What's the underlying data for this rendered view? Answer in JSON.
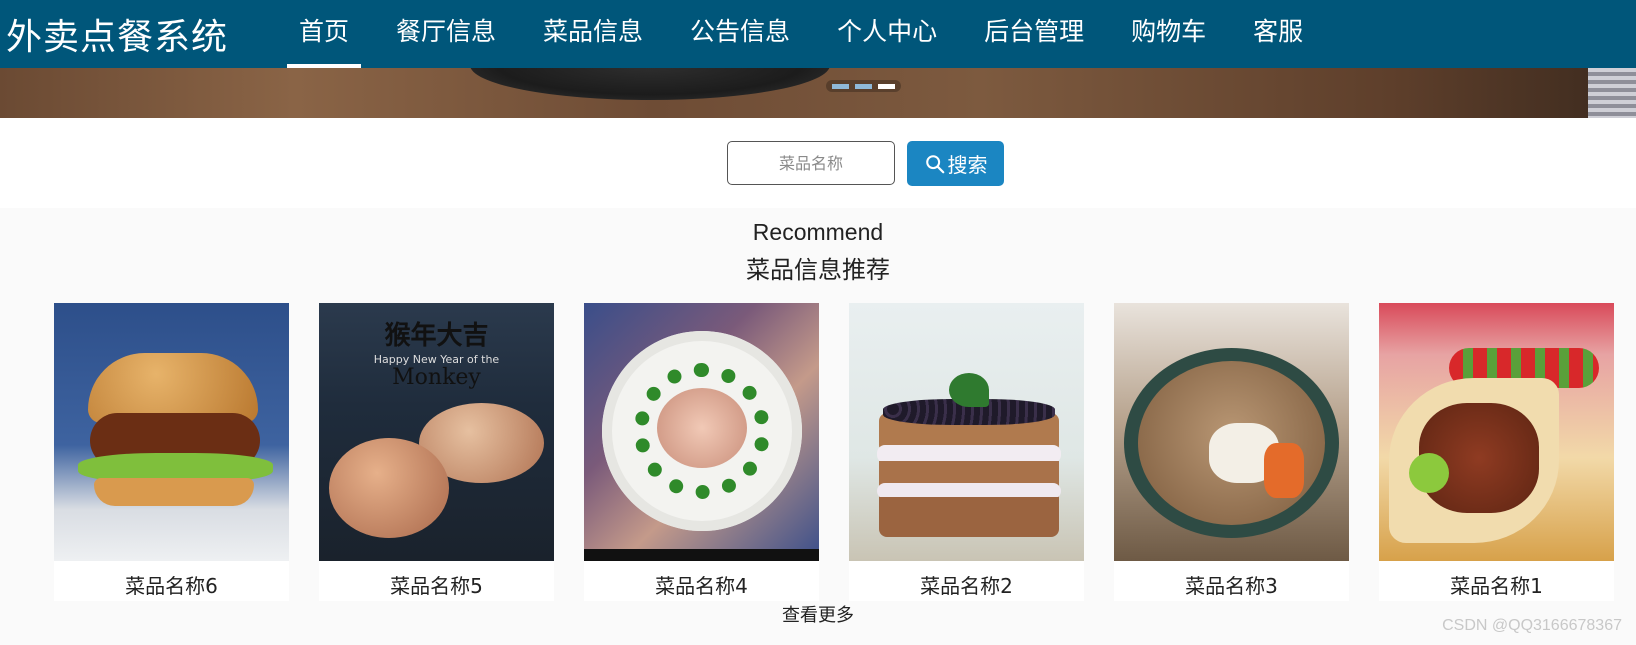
{
  "brand": "外卖点餐系统",
  "nav": {
    "items": [
      {
        "label": "首页",
        "active": true
      },
      {
        "label": "餐厅信息",
        "active": false
      },
      {
        "label": "菜品信息",
        "active": false
      },
      {
        "label": "公告信息",
        "active": false
      },
      {
        "label": "个人中心",
        "active": false
      },
      {
        "label": "后台管理",
        "active": false
      },
      {
        "label": "购物车",
        "active": false
      },
      {
        "label": "客服",
        "active": false
      }
    ]
  },
  "carousel": {
    "slide_count": 3,
    "active_index": 2
  },
  "search": {
    "placeholder": "菜品名称",
    "value": "",
    "button_label": "搜索",
    "icon": "search-icon"
  },
  "recommend": {
    "title_en": "Recommend",
    "title_cn": "菜品信息推荐",
    "items": [
      {
        "name": "菜品名称6",
        "image": "burger"
      },
      {
        "name": "菜品名称5",
        "image": "cookies"
      },
      {
        "name": "菜品名称4",
        "image": "plated-dish"
      },
      {
        "name": "菜品名称2",
        "image": "blackberry-cake"
      },
      {
        "name": "菜品名称3",
        "image": "stew-soup"
      },
      {
        "name": "菜品名称1",
        "image": "tacos"
      }
    ],
    "more_label": "查看更多"
  },
  "cookie_image_text": {
    "cn": "猴年大吉",
    "sub": "Happy New Year of the",
    "monkey": "Monkey"
  },
  "watermark": "CSDN @QQ3166678367",
  "colors": {
    "nav_bg": "#00567a",
    "button_bg": "#1b86c2",
    "section_bg": "#fafafa"
  }
}
